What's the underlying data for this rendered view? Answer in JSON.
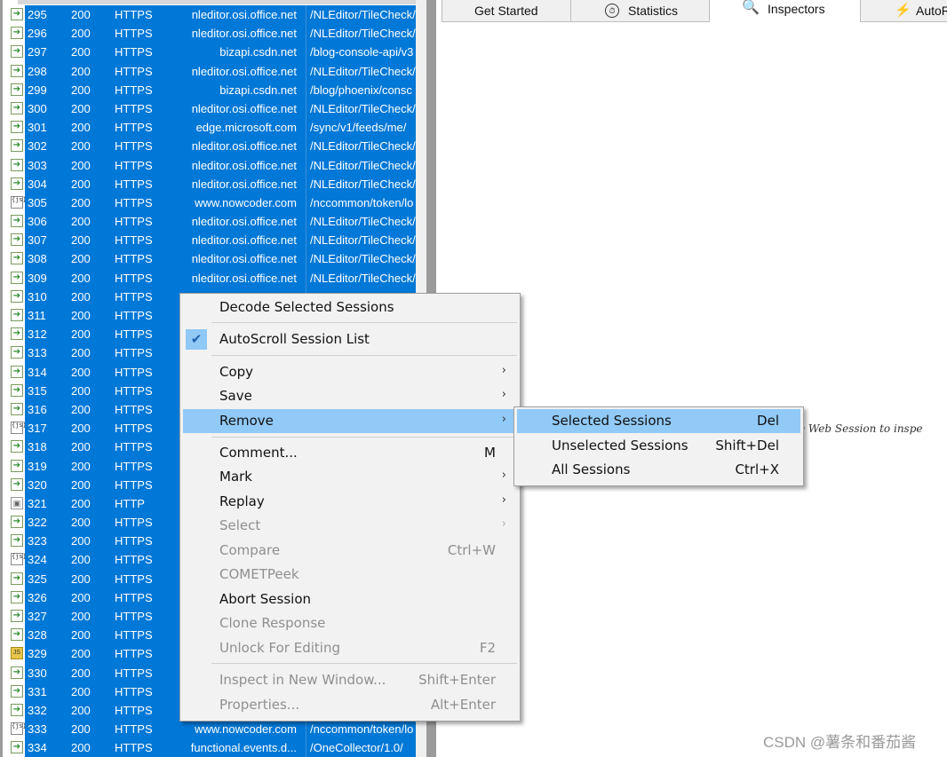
{
  "sessions": [
    {
      "id": "295",
      "result": "200",
      "protocol": "HTTPS",
      "host": "nleditor.osi.office.net",
      "url": "/NLEditor/TileCheck/",
      "icon": "response-arrow-icon"
    },
    {
      "id": "296",
      "result": "200",
      "protocol": "HTTPS",
      "host": "nleditor.osi.office.net",
      "url": "/NLEditor/TileCheck/",
      "icon": "response-arrow-icon"
    },
    {
      "id": "297",
      "result": "200",
      "protocol": "HTTPS",
      "host": "bizapi.csdn.net",
      "url": "/blog-console-api/v3",
      "icon": "response-arrow-icon"
    },
    {
      "id": "298",
      "result": "200",
      "protocol": "HTTPS",
      "host": "nleditor.osi.office.net",
      "url": "/NLEditor/TileCheck/",
      "icon": "response-arrow-icon"
    },
    {
      "id": "299",
      "result": "200",
      "protocol": "HTTPS",
      "host": "bizapi.csdn.net",
      "url": "/blog/phoenix/consc",
      "icon": "response-arrow-icon"
    },
    {
      "id": "300",
      "result": "200",
      "protocol": "HTTPS",
      "host": "nleditor.osi.office.net",
      "url": "/NLEditor/TileCheck/",
      "icon": "response-arrow-icon"
    },
    {
      "id": "301",
      "result": "200",
      "protocol": "HTTPS",
      "host": "edge.microsoft.com",
      "url": "/sync/v1/feeds/me/",
      "icon": "response-arrow-icon"
    },
    {
      "id": "302",
      "result": "200",
      "protocol": "HTTPS",
      "host": "nleditor.osi.office.net",
      "url": "/NLEditor/TileCheck/",
      "icon": "response-arrow-icon"
    },
    {
      "id": "303",
      "result": "200",
      "protocol": "HTTPS",
      "host": "nleditor.osi.office.net",
      "url": "/NLEditor/TileCheck/",
      "icon": "response-arrow-icon"
    },
    {
      "id": "304",
      "result": "200",
      "protocol": "HTTPS",
      "host": "nleditor.osi.office.net",
      "url": "/NLEditor/TileCheck/",
      "icon": "response-arrow-icon"
    },
    {
      "id": "305",
      "result": "200",
      "protocol": "HTTPS",
      "host": "www.nowcoder.com",
      "url": "/nccommon/token/lo",
      "icon": "json-icon"
    },
    {
      "id": "306",
      "result": "200",
      "protocol": "HTTPS",
      "host": "nleditor.osi.office.net",
      "url": "/NLEditor/TileCheck/",
      "icon": "response-arrow-icon"
    },
    {
      "id": "307",
      "result": "200",
      "protocol": "HTTPS",
      "host": "nleditor.osi.office.net",
      "url": "/NLEditor/TileCheck/",
      "icon": "response-arrow-icon"
    },
    {
      "id": "308",
      "result": "200",
      "protocol": "HTTPS",
      "host": "nleditor.osi.office.net",
      "url": "/NLEditor/TileCheck/",
      "icon": "response-arrow-icon"
    },
    {
      "id": "309",
      "result": "200",
      "protocol": "HTTPS",
      "host": "nleditor.osi.office.net",
      "url": "/NLEditor/TileCheck/",
      "icon": "response-arrow-icon"
    },
    {
      "id": "310",
      "result": "200",
      "protocol": "HTTPS",
      "host": "",
      "url": "",
      "icon": "response-arrow-icon"
    },
    {
      "id": "311",
      "result": "200",
      "protocol": "HTTPS",
      "host": "",
      "url": "",
      "icon": "response-arrow-icon"
    },
    {
      "id": "312",
      "result": "200",
      "protocol": "HTTPS",
      "host": "",
      "url": "",
      "icon": "response-arrow-icon"
    },
    {
      "id": "313",
      "result": "200",
      "protocol": "HTTPS",
      "host": "",
      "url": "",
      "icon": "response-arrow-icon"
    },
    {
      "id": "314",
      "result": "200",
      "protocol": "HTTPS",
      "host": "",
      "url": "",
      "icon": "response-arrow-icon"
    },
    {
      "id": "315",
      "result": "200",
      "protocol": "HTTPS",
      "host": "",
      "url": "",
      "icon": "response-arrow-icon"
    },
    {
      "id": "316",
      "result": "200",
      "protocol": "HTTPS",
      "host": "",
      "url": "",
      "icon": "response-arrow-icon"
    },
    {
      "id": "317",
      "result": "200",
      "protocol": "HTTPS",
      "host": "",
      "url": "",
      "icon": "json-icon"
    },
    {
      "id": "318",
      "result": "200",
      "protocol": "HTTPS",
      "host": "",
      "url": "",
      "icon": "response-arrow-icon"
    },
    {
      "id": "319",
      "result": "200",
      "protocol": "HTTPS",
      "host": "",
      "url": "",
      "icon": "response-arrow-icon"
    },
    {
      "id": "320",
      "result": "200",
      "protocol": "HTTPS",
      "host": "",
      "url": "",
      "icon": "response-arrow-icon"
    },
    {
      "id": "321",
      "result": "200",
      "protocol": "HTTP",
      "host": "",
      "url": "",
      "icon": "lock-icon"
    },
    {
      "id": "322",
      "result": "200",
      "protocol": "HTTPS",
      "host": "",
      "url": "",
      "icon": "response-arrow-icon"
    },
    {
      "id": "323",
      "result": "200",
      "protocol": "HTTPS",
      "host": "",
      "url": "",
      "icon": "response-arrow-icon"
    },
    {
      "id": "324",
      "result": "200",
      "protocol": "HTTPS",
      "host": "",
      "url": "",
      "icon": "json-icon"
    },
    {
      "id": "325",
      "result": "200",
      "protocol": "HTTPS",
      "host": "",
      "url": "",
      "icon": "response-arrow-icon"
    },
    {
      "id": "326",
      "result": "200",
      "protocol": "HTTPS",
      "host": "",
      "url": "",
      "icon": "response-arrow-icon"
    },
    {
      "id": "327",
      "result": "200",
      "protocol": "HTTPS",
      "host": "",
      "url": "",
      "icon": "response-arrow-icon"
    },
    {
      "id": "328",
      "result": "200",
      "protocol": "HTTPS",
      "host": "",
      "url": "",
      "icon": "response-arrow-icon"
    },
    {
      "id": "329",
      "result": "200",
      "protocol": "HTTPS",
      "host": "",
      "url": "",
      "icon": "js-icon"
    },
    {
      "id": "330",
      "result": "200",
      "protocol": "HTTPS",
      "host": "",
      "url": "",
      "icon": "response-arrow-icon"
    },
    {
      "id": "331",
      "result": "200",
      "protocol": "HTTPS",
      "host": "",
      "url": "",
      "icon": "response-arrow-icon"
    },
    {
      "id": "332",
      "result": "200",
      "protocol": "HTTPS",
      "host": "",
      "url": "",
      "icon": "response-arrow-icon"
    },
    {
      "id": "333",
      "result": "200",
      "protocol": "HTTPS",
      "host": "www.nowcoder.com",
      "url": "/nccommon/token/lo",
      "icon": "json-icon"
    },
    {
      "id": "334",
      "result": "200",
      "protocol": "HTTPS",
      "host": "functional.events.d...",
      "url": "/OneCollector/1.0/",
      "icon": "response-arrow-icon"
    }
  ],
  "tabs": {
    "get_started": "Get Started",
    "statistics": "Statistics",
    "inspectors": "Inspectors",
    "autoresponder": "AutoR"
  },
  "context_menu": {
    "decode": "Decode Selected Sessions",
    "autoscroll": "AutoScroll Session List",
    "copy": "Copy",
    "save": "Save",
    "remove": "Remove",
    "comment": "Comment...",
    "comment_shortcut": "M",
    "mark": "Mark",
    "replay": "Replay",
    "select": "Select",
    "compare": "Compare",
    "compare_shortcut": "Ctrl+W",
    "cometpeek": "COMETPeek",
    "abort": "Abort Session",
    "clone": "Clone Response",
    "unlock": "Unlock For Editing",
    "unlock_shortcut": "F2",
    "inspect_new_window": "Inspect in New Window...",
    "inspect_shortcut": "Shift+Enter",
    "properties": "Properties...",
    "properties_shortcut": "Alt+Enter"
  },
  "remove_submenu": {
    "selected": "Selected Sessions",
    "selected_shortcut": "Del",
    "unselected": "Unselected Sessions",
    "unselected_shortcut": "Shift+Del",
    "all": "All Sessions",
    "all_shortcut": "Ctrl+X"
  },
  "hint_text": "e Web Session to inspe",
  "watermark": "CSDN @薯条和番茄酱",
  "colors": {
    "selection": "#0078d7",
    "menu_highlight": "#91c9f7",
    "menu_background": "#f2f2f2"
  }
}
